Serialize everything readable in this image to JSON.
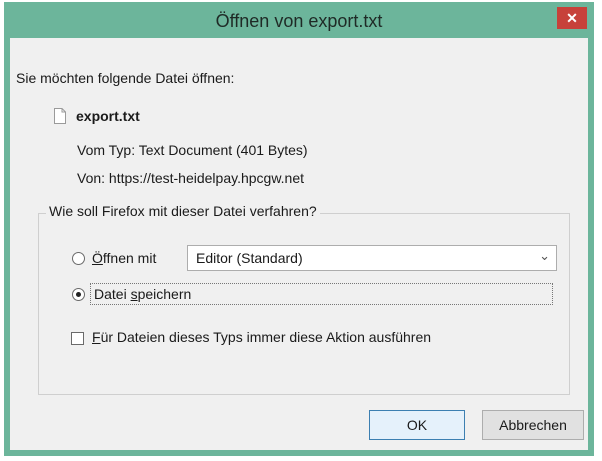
{
  "dialog": {
    "title": "Öffnen von export.txt",
    "intro": "Sie möchten folgende Datei öffnen:",
    "file_name": "export.txt",
    "type_label": "Vom Typ:",
    "type_value": "Text Document (401 Bytes)",
    "from_label": "Von:",
    "from_value": "https://test-heidelpay.hpcgw.net",
    "group_label": "Wie soll Firefox mit dieser Datei verfahren?",
    "open_with": {
      "mnemonic": "Ö",
      "rest": "ffnen mit",
      "selected": false,
      "app_selected": "Editor (Standard)"
    },
    "save_file": {
      "pre": "Datei ",
      "mnemonic": "s",
      "rest": "peichern",
      "selected": true
    },
    "always_action": {
      "mnemonic": "F",
      "rest": "ür Dateien dieses Typs immer diese Aktion ausführen",
      "checked": false
    },
    "ok_label": "OK",
    "cancel_label": "Abbrechen"
  },
  "icons": {
    "close": "close-icon",
    "file": "text-file-icon",
    "dropdown": "chevron-down-icon"
  },
  "colors": {
    "titlebar": "#6cb59b",
    "close_button": "#c7413a",
    "client_bg": "#f0f0f0",
    "ok_border": "#3c7fb1"
  }
}
